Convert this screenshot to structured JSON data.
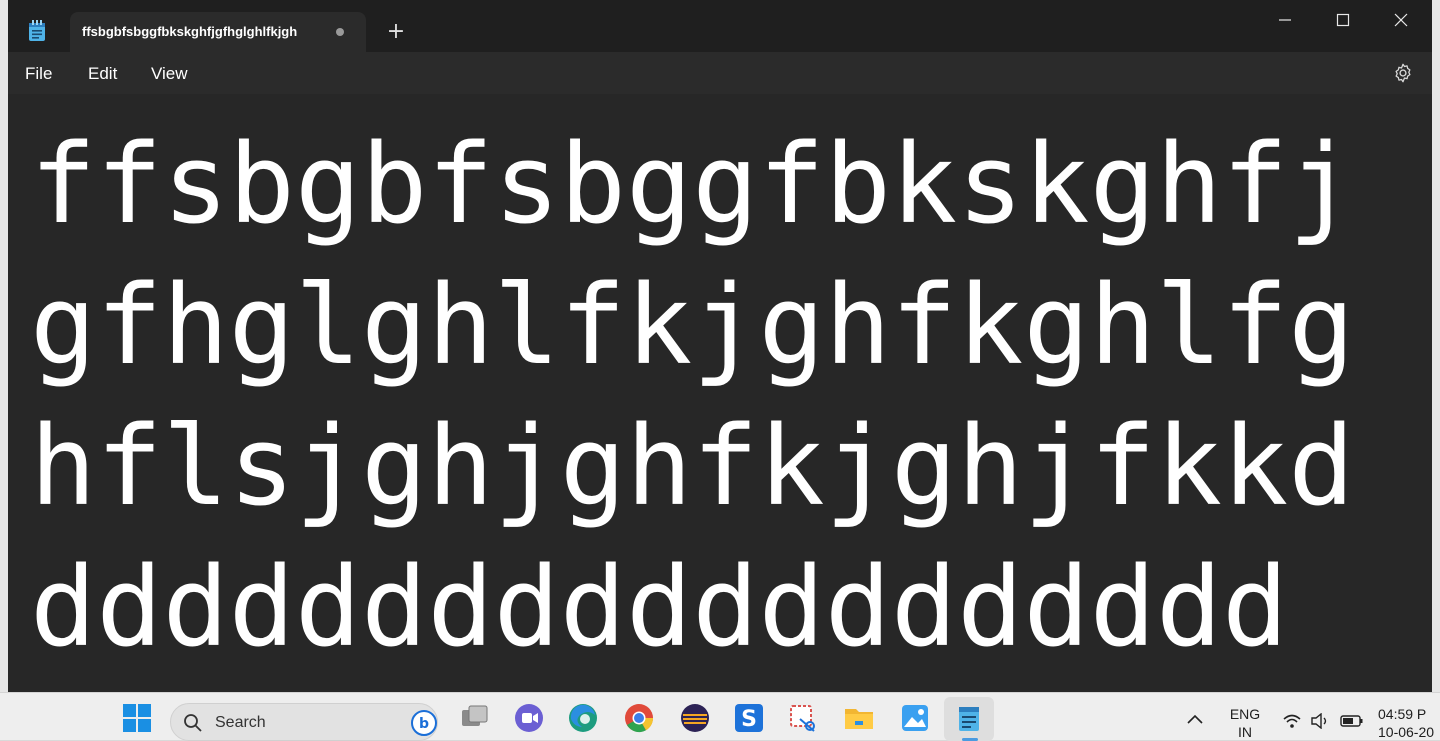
{
  "window": {
    "tab_title": "ffsbgbfsbggfbkskghfjgfhglghlfkjgh",
    "new_tab_label": "+"
  },
  "menu": {
    "file": "File",
    "edit": "Edit",
    "view": "View"
  },
  "editor": {
    "content": "ffsbgbfsbggfbkskghfjgfhglghlfkjghfkghlfghflsjghjghfkjghjfkkdddddddddddddddddddd"
  },
  "taskbar": {
    "search_label": "Search",
    "language_line1": "ENG",
    "language_line2": "IN",
    "time": "04:59 P",
    "date": "10-06-20",
    "apps": [
      "start-icon",
      "copilot-bing-icon",
      "task-view-icon",
      "teams-chat-icon",
      "edge-icon",
      "chrome-icon",
      "eclipse-icon",
      "sourcetree-icon",
      "snipping-tool-icon",
      "file-explorer-icon",
      "photos-icon",
      "notepad-icon"
    ]
  },
  "colors": {
    "titlebar": "#1f1f1f",
    "menubar": "#2b2b2b",
    "editor_bg": "#272727",
    "text": "#ffffff",
    "taskbar": "#eeeeee",
    "accent": "#4a9be0"
  }
}
